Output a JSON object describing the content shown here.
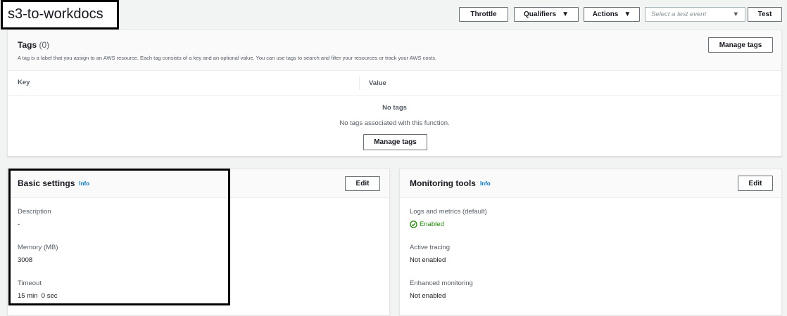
{
  "title": "s3-to-workdocs",
  "toolbar": {
    "throttle": "Throttle",
    "qualifiers": "Qualifiers",
    "actions": "Actions",
    "test_event_placeholder": "Select a test event",
    "test": "Test"
  },
  "tags": {
    "title": "Tags",
    "count": "(0)",
    "description": "A tag is a label that you assign to an AWS resource. Each tag consists of a key and an optional value. You can use tags to search and filter your resources or track your AWS costs.",
    "manage": "Manage tags",
    "columns": [
      "Key",
      "Value"
    ],
    "empty_title": "No tags",
    "empty_text": "No tags associated with this function.",
    "manage_empty": "Manage tags"
  },
  "basic": {
    "title": "Basic settings",
    "info": "Info",
    "edit": "Edit",
    "fields": [
      {
        "label": "Description",
        "value": "-"
      },
      {
        "label": "Memory (MB)",
        "value": "3008"
      },
      {
        "label": "Timeout",
        "value": "15 min  0 sec"
      }
    ]
  },
  "monitoring": {
    "title": "Monitoring tools",
    "info": "Info",
    "edit": "Edit",
    "fields": [
      {
        "label": "Logs and metrics (default)",
        "value": "Enabled"
      },
      {
        "label": "Active tracing",
        "value": "Not enabled"
      },
      {
        "label": "Enhanced monitoring",
        "value": "Not enabled"
      }
    ]
  },
  "colors": {
    "enabled": "#1d8102",
    "link": "#0073bb"
  }
}
